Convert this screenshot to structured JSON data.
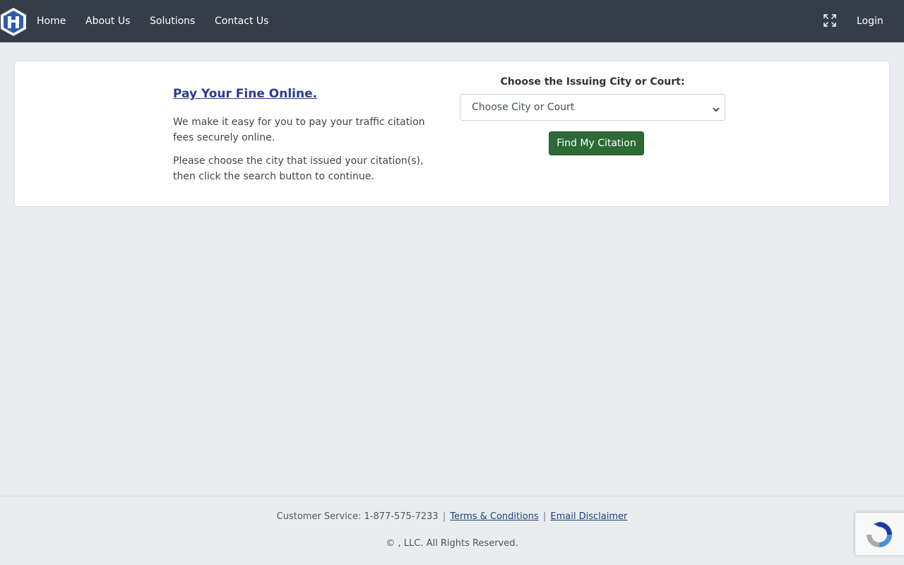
{
  "navbar": {
    "logo": "hexagon-logo",
    "links": [
      "Home",
      "About Us",
      "Solutions",
      "Contact Us"
    ],
    "fullscreen_icon": "expand-icon",
    "login": "Login",
    "colors": {
      "background": "#343d48",
      "text": "#ffffff"
    }
  },
  "intro": {
    "title": "Pay Your Fine Online.",
    "paragraph1": "We make it easy for you to pay your traffic citation fees securely online.",
    "paragraph2": "Please choose the city that issued your citation(s), then click the search button to continue."
  },
  "search": {
    "label": "Choose the Issuing City or Court:",
    "select_value": "Choose City or Court",
    "button": "Find My Citation",
    "button_color": "#2d6a37"
  },
  "footer": {
    "customer_service": "Customer Service: 1-877-575-7233",
    "separator": "|",
    "terms": "Terms & Conditions",
    "email_disclaimer": "Email Disclaimer",
    "copyright": "© , LLC. All Rights Reserved."
  },
  "recaptcha": {
    "icon": "recaptcha-icon"
  },
  "colors": {
    "page_background": "#e9edf0",
    "title_link": "#2c3b8e"
  }
}
